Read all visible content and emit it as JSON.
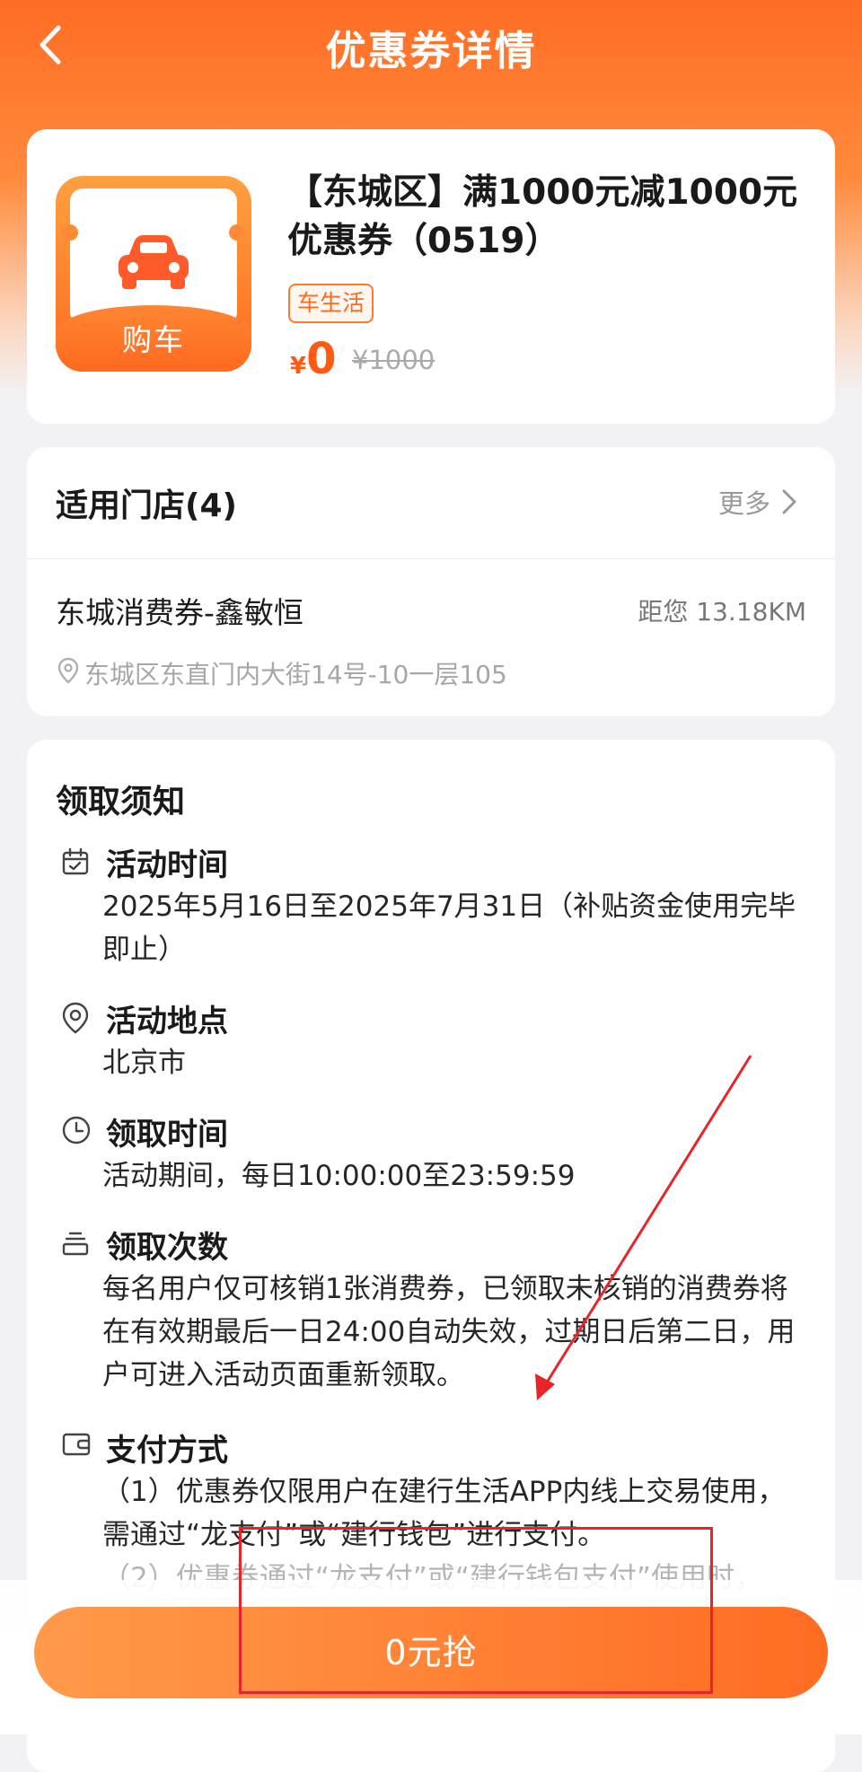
{
  "header": {
    "title": "优惠券详情",
    "back_icon": "chevron-left-icon"
  },
  "product": {
    "icon_label": "购车",
    "icon": "car-icon",
    "title": "【东城区】满1000元减1000元优惠券（0519）",
    "tag": "车生活",
    "currency": "¥",
    "price": "0",
    "original_price": "¥1000"
  },
  "stores": {
    "title": "适用门店(4)",
    "more_label": "更多",
    "items": [
      {
        "name": "东城消费券-鑫敏恒",
        "distance": "距您 13.18KM",
        "address": "东城区东直门内大街14号-10一层105"
      }
    ]
  },
  "notice": {
    "title": "领取须知",
    "items": [
      {
        "icon": "calendar-icon",
        "title": "活动时间",
        "body": [
          "2025年5月16日至2025年7月31日（补贴资金使用完毕即止）"
        ]
      },
      {
        "icon": "location-pin-icon",
        "title": "活动地点",
        "body": [
          "北京市"
        ]
      },
      {
        "icon": "clock-icon",
        "title": "领取时间",
        "body": [
          "活动期间，每日10:00:00至23:59:59"
        ]
      },
      {
        "icon": "stack-icon",
        "title": "领取次数",
        "body": [
          "每名用户仅可核销1张消费券，已领取未核销的消费券将在有效期最后一日24:00自动失效，过期日后第二日，用户可进入活动页面重新领取。"
        ]
      },
      {
        "icon": "wallet-icon",
        "title": "支付方式",
        "body": [
          "（1）优惠券仅限用户在建行生活APP内线上交易使用，需通过“龙支付”或“建行钱包”进行支付。",
          "（2）优惠券通过“龙支付”或“建行钱包支付”使用时，"
        ]
      }
    ]
  },
  "cta": {
    "label": "0元抢"
  },
  "colors": {
    "brand_orange": "#ff6a1f",
    "price_red": "#ff5a12",
    "annotation_red": "#e8242a"
  }
}
